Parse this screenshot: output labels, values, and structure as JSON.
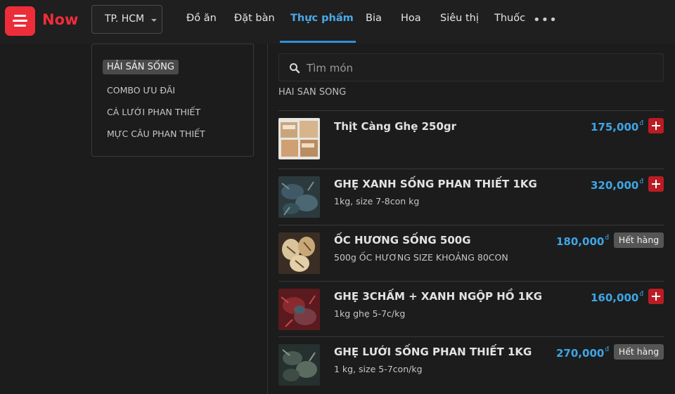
{
  "header": {
    "logo_text": "Now",
    "city": "TP. HCM",
    "tabs": [
      "Đồ ăn",
      "Đặt bàn",
      "Thực phẩm",
      "Bia",
      "Hoa",
      "Siêu thị",
      "Thuốc"
    ],
    "active_tab": "Thực phẩm",
    "more_label": "•••"
  },
  "categories": [
    {
      "label": "HẢI SẢN SỐNG",
      "active": true
    },
    {
      "label": "COMBO ƯU ĐÃI",
      "active": false
    },
    {
      "label": "CÁ LƯỚI PHAN THIẾT",
      "active": false
    },
    {
      "label": "MỰC CÂU PHAN THIẾT",
      "active": false
    }
  ],
  "search": {
    "placeholder": "Tìm món"
  },
  "section_title": "HAI SAN SONG",
  "currency_symbol": "đ",
  "products": [
    {
      "name": "Thịt Càng Ghẹ 250gr",
      "desc": "",
      "price": "175,000",
      "status": "add"
    },
    {
      "name": "GHẸ XANH SỐNG PHAN THIẾT 1KG",
      "desc": "1kg, size 7-8con kg",
      "price": "320,000",
      "status": "add"
    },
    {
      "name": "ỐC HƯƠNG SỐNG 500G",
      "desc": "500g ỐC HƯƠNG SIZE KHOẢNG 80CON",
      "price": "180,000",
      "status": "Hết hàng"
    },
    {
      "name": "GHẸ 3CHẤM + XANH NGỘP HỒ 1KG",
      "desc": "1kg ghẹ 5-7c/kg",
      "price": "160,000",
      "status": "add"
    },
    {
      "name": "GHẸ LƯỚI SỐNG PHAN THIẾT 1KG",
      "desc": "1 kg, size 5-7con/kg",
      "price": "270,000",
      "status": "Hết hàng"
    }
  ],
  "colors": {
    "brand": "#ee2d3a",
    "accent": "#3ea6e6",
    "add_button": "#b91c24"
  }
}
